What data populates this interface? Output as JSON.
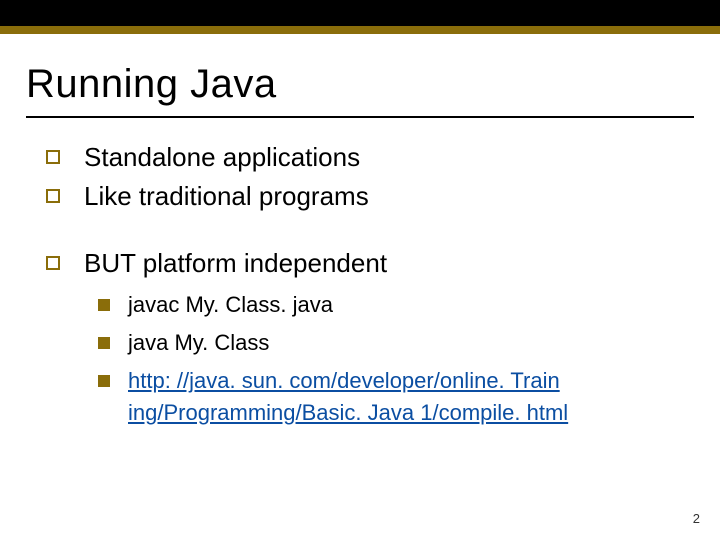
{
  "title": "Running Java",
  "bullets": {
    "b1": "Standalone applications",
    "b2": "Like traditional programs",
    "b3": "BUT platform independent"
  },
  "sub": {
    "s1": "javac My. Class. java",
    "s2": "java   My. Class",
    "link": "http: //java. sun. com/developer/online. Train ing/Programming/Basic. Java 1/compile. html"
  },
  "page_number": "2"
}
